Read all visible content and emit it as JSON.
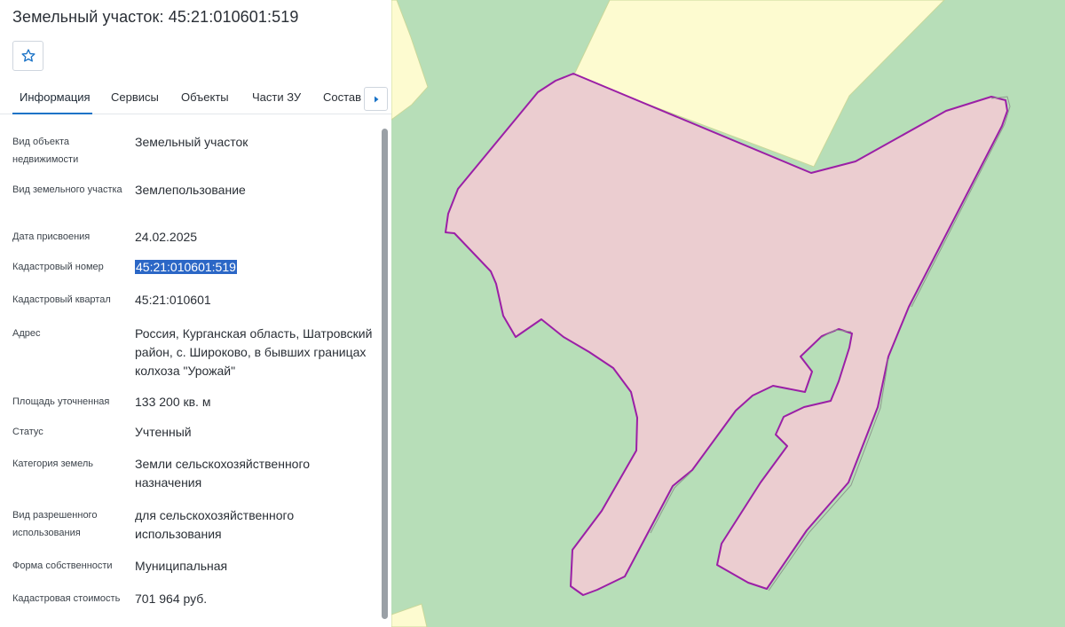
{
  "header": {
    "title": "Земельный участок: 45:21:010601:519"
  },
  "tabs": [
    {
      "label": "Информация"
    },
    {
      "label": "Сервисы"
    },
    {
      "label": "Объекты"
    },
    {
      "label": "Части ЗУ"
    },
    {
      "label": "Состав"
    }
  ],
  "properties": [
    {
      "label": "Вид объекта недвижимости",
      "value": "Земельный участок"
    },
    {
      "label": "Вид земельного участка",
      "value": "Землепользование"
    },
    {
      "label": "Дата присвоения",
      "value": "24.02.2025"
    },
    {
      "label": "Кадастровый номер",
      "value": "45:21:010601:519"
    },
    {
      "label": "Кадастровый квартал",
      "value": "45:21:010601"
    },
    {
      "label": "Адрес",
      "value": "Россия, Курганская область, Шатровский район, с. Широково, в бывших границах колхоза \"Урожай\""
    },
    {
      "label": "Площадь уточненная",
      "value": "133 200 кв. м"
    },
    {
      "label": "Статус",
      "value": "Учтенный"
    },
    {
      "label": "Категория земель",
      "value": "Земли сельскохозяйственного назначения"
    },
    {
      "label": "Вид разрешенного использования",
      "value": "для сельскохозяйственного использования"
    },
    {
      "label": "Форма собственности",
      "value": "Муниципальная"
    },
    {
      "label": "Кадастровая стоимость",
      "value": "701 964 руб."
    }
  ],
  "icons": {
    "favorite": "star-outline-icon",
    "tabs_next": "caret-right-icon"
  },
  "colors": {
    "accent": "#1a73c7",
    "selection": "#2b67c6",
    "map_background": "#b7deb8",
    "map_yellow_area": "#fdfbd0",
    "parcel_fill": "#ebcdd0",
    "parcel_border": "#9b1fa6"
  }
}
